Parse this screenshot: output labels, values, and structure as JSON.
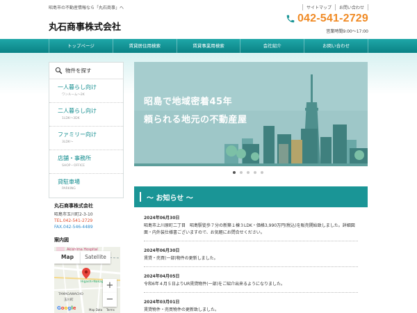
{
  "header": {
    "tagline": "昭島市の不動産情報なら「丸石商事」へ",
    "company": "丸石商事株式会社",
    "links": [
      "サイトマップ",
      "お問い合わせ"
    ],
    "phone": "042-541-2729",
    "hours": "営業時間9:00～17:00"
  },
  "nav": [
    "トップページ",
    "賃貸居住用検索",
    "賃貸事業用検索",
    "会社紹介",
    "お問い合わせ"
  ],
  "sidebar": {
    "heading": "物件を探す",
    "categories": [
      {
        "title": "一人暮らし向け",
        "sub": "ワンルーム〜2K"
      },
      {
        "title": "二人暮らし向け",
        "sub": "1LDK〜3DK"
      },
      {
        "title": "ファミリー向け",
        "sub": "3LDK〜"
      },
      {
        "title": "店舗・事務所",
        "sub": "SHOP・OFFICE"
      },
      {
        "title": "貸駐車場",
        "sub": "PARKING"
      }
    ]
  },
  "contact": {
    "name": "丸石商事株式会社",
    "address": "昭島市玉川町2-3-10",
    "tel": "TEL.042-541-2729",
    "fax": "FAX.042-546-4489"
  },
  "map": {
    "title": "案内図",
    "tabs": [
      "Map",
      "Satellite"
    ],
    "zoom_in": "+",
    "zoom_out": "−",
    "labels": {
      "hospital": "Akishima Hospital",
      "station": "Higashi-Nakagami",
      "district": "TAMAGAWACHO",
      "district_jp": "玉川町"
    },
    "google": [
      "G",
      "o",
      "o",
      "g",
      "l",
      "e"
    ],
    "footer": [
      "Map Data",
      "Terms"
    ]
  },
  "hero": {
    "line1": "昭島で地域密着45年",
    "line2": "頼られる地元の不動産屋",
    "slides": 5,
    "active_slide": 0
  },
  "news": {
    "title": "～ お知らせ ～",
    "items": [
      {
        "date": "2024年06月30日",
        "body": "昭島市上川原町二丁目　昭島駅徒歩７分の新築１棟３LDK・価格3,990万円(税込)を販売開始致しました。詳細図面・内外装仕様書ございますので、お気軽にお問合せください。"
      },
      {
        "date": "2024年06月30日",
        "body": "賃貸・売買(一部)物件の更新しました。"
      },
      {
        "date": "2024年04月05日",
        "body": "令和6年４月５日よりUR賃貸物件(一部)をご紹介出来るようになりました。"
      },
      {
        "date": "2024年03月01日",
        "body": "賃貸物件・売買物件の更新致しました。"
      }
    ]
  },
  "colors": {
    "teal": "#1a9596",
    "orange": "#f08a24",
    "tel": "#e04b2a",
    "fax": "#2d8ccc"
  }
}
